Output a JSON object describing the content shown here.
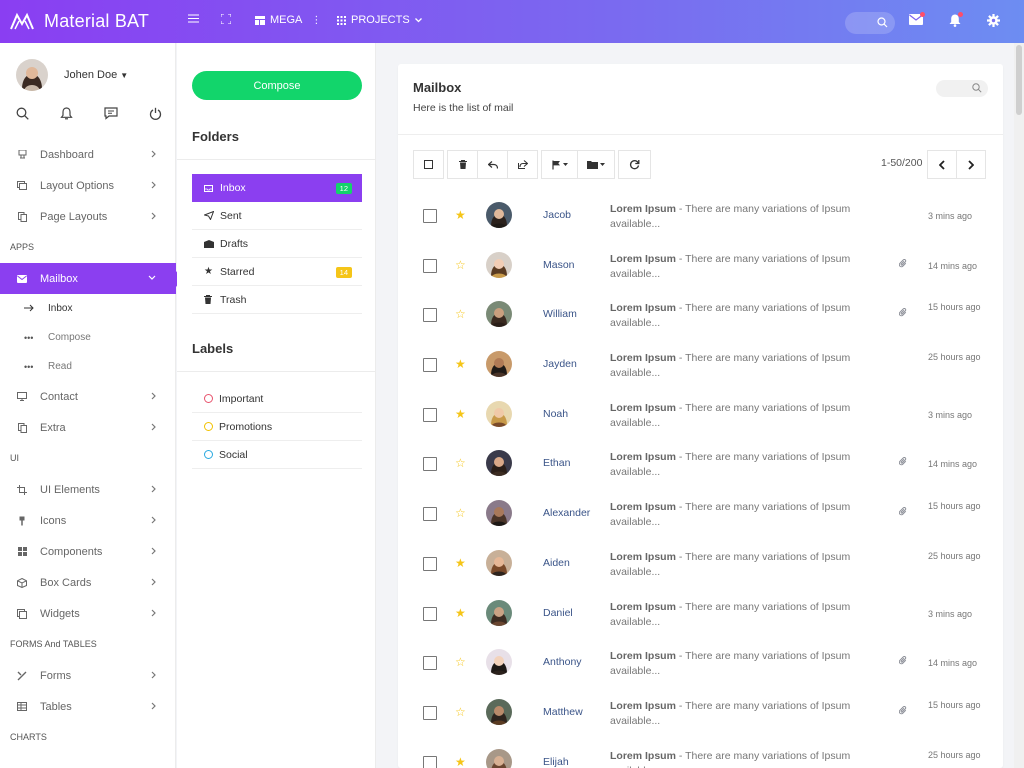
{
  "app": {
    "brand": "Material BAT"
  },
  "topbar": {
    "mega": "MEGA",
    "projects": "PROJECTS"
  },
  "user": {
    "name": "Johen Doe"
  },
  "nav": {
    "dashboard": "Dashboard",
    "layout_options": "Layout Options",
    "page_layouts": "Page Layouts",
    "section_apps": "APPS",
    "mailbox": "Mailbox",
    "inbox": "Inbox",
    "compose": "Compose",
    "read": "Read",
    "contact": "Contact",
    "extra": "Extra",
    "section_ui": "UI",
    "ui_elements": "UI Elements",
    "icons": "Icons",
    "components": "Components",
    "box_cards": "Box Cards",
    "widgets": "Widgets",
    "section_forms": "FORMS And TABLES",
    "forms": "Forms",
    "tables": "Tables",
    "section_charts": "CHARTS"
  },
  "folders_panel": {
    "compose_label": "Compose",
    "folders_title": "Folders",
    "folders": [
      {
        "label": "Inbox",
        "badge": "12",
        "badge_color": "#14d36b"
      },
      {
        "label": "Sent"
      },
      {
        "label": "Drafts"
      },
      {
        "label": "Starred",
        "badge": "14",
        "badge_color": "#f5c518"
      },
      {
        "label": "Trash"
      }
    ],
    "labels_title": "Labels",
    "labels": [
      {
        "label": "Important",
        "color": "#e8536d"
      },
      {
        "label": "Promotions",
        "color": "#f2c200"
      },
      {
        "label": "Social",
        "color": "#29a9e0"
      }
    ]
  },
  "mailbox": {
    "title": "Mailbox",
    "subtitle": "Here is the list of mail",
    "pager": "1-50/200",
    "snippet_bold": "Lorem Ipsum",
    "snippet_text": " - There are many variations of Ipsum available...",
    "mails": [
      {
        "sender": "Jacob",
        "starred": true,
        "attachment": false,
        "time": "3 mins ago"
      },
      {
        "sender": "Mason",
        "starred": false,
        "attachment": true,
        "time": "14 mins ago"
      },
      {
        "sender": "William",
        "starred": false,
        "attachment": true,
        "time": "15 hours ago"
      },
      {
        "sender": "Jayden",
        "starred": true,
        "attachment": false,
        "time": "25 hours ago"
      },
      {
        "sender": "Noah",
        "starred": true,
        "attachment": false,
        "time": "3 mins ago"
      },
      {
        "sender": "Ethan",
        "starred": false,
        "attachment": true,
        "time": "14 mins ago"
      },
      {
        "sender": "Alexander",
        "starred": false,
        "attachment": true,
        "time": "15 hours ago"
      },
      {
        "sender": "Aiden",
        "starred": true,
        "attachment": false,
        "time": "25 hours ago"
      },
      {
        "sender": "Daniel",
        "starred": true,
        "attachment": false,
        "time": "3 mins ago"
      },
      {
        "sender": "Anthony",
        "starred": false,
        "attachment": true,
        "time": "14 mins ago"
      },
      {
        "sender": "Matthew",
        "starred": false,
        "attachment": true,
        "time": "15 hours ago"
      },
      {
        "sender": "Elijah",
        "starred": true,
        "attachment": false,
        "time": "25 hours ago"
      }
    ]
  },
  "colors": {
    "accent": "#8b3ff0",
    "compose": "#12d56b",
    "star": "#f5c518",
    "sender": "#3a5488"
  },
  "icons": {
    "brand": "brand-logo-icon",
    "menu": "hamburger-icon",
    "fullscreen": "fullscreen-icon",
    "mail": "envelope-icon",
    "bell": "bell-icon",
    "settings": "gear-icon"
  }
}
